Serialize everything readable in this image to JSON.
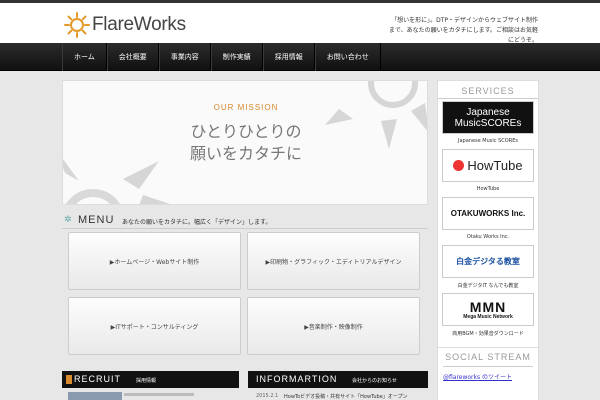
{
  "header": {
    "logo_text": "FlareWorks",
    "tagline": "「想いを形に」。DTP・デザインからウェブサイト制作まで、あなたの願いをカタチにします。ご相談はお気軽にどうぞ。"
  },
  "nav": {
    "items": [
      {
        "label": "ホーム"
      },
      {
        "label": "会社概要"
      },
      {
        "label": "事業内容"
      },
      {
        "label": "制作実績"
      },
      {
        "label": "採用情報"
      },
      {
        "label": "お問い合わせ"
      }
    ]
  },
  "hero": {
    "mission": "OUR MISSION",
    "line1": "ひとりひとりの",
    "line2": "願いをカタチに"
  },
  "menu": {
    "title": "MENU",
    "desc": "あなたの願いをカタチに。幅広く「デザイン」します。",
    "buttons": [
      {
        "label": "▶ホームページ・Webサイト制作"
      },
      {
        "label": "▶印刷物・グラフィック・エディトリアルデザイン"
      },
      {
        "label": "▶ITサポート・コンサルティング"
      },
      {
        "label": "▶音楽制作・映像制作"
      }
    ]
  },
  "recruit": {
    "label": "RECRUIT",
    "sub": "採用情報"
  },
  "info": {
    "label": "INFORMARTION",
    "sub": "会社からのお知らせ",
    "date": "2015.2.1",
    "text": "HowToビデオ投稿・共有サイト「HowTube」オープン"
  },
  "sidebar": {
    "services_title": "SERVICES",
    "items": [
      {
        "logo_line1": "Japanese",
        "logo_line2": "MusicSCOREs",
        "caption": "Japanese Music SCOREs"
      },
      {
        "logo": "HowTube",
        "caption": "HowTube"
      },
      {
        "logo": "OTAKUWORKS Inc.",
        "caption": "Otaku Works Inc."
      },
      {
        "logo": "白金デジタる教室",
        "caption": "白金デジタIT なんでも教室"
      },
      {
        "logo": "Mega Music Network",
        "caption": "商用BGM・効果音ダウンロード"
      }
    ],
    "social_title": "SOCIAL STREAM",
    "twitter": "@flareworks のツイート"
  },
  "colors": {
    "accent": "#d88a2e",
    "nav_bg": "#1a1a1a",
    "bar_bg": "#111111"
  }
}
